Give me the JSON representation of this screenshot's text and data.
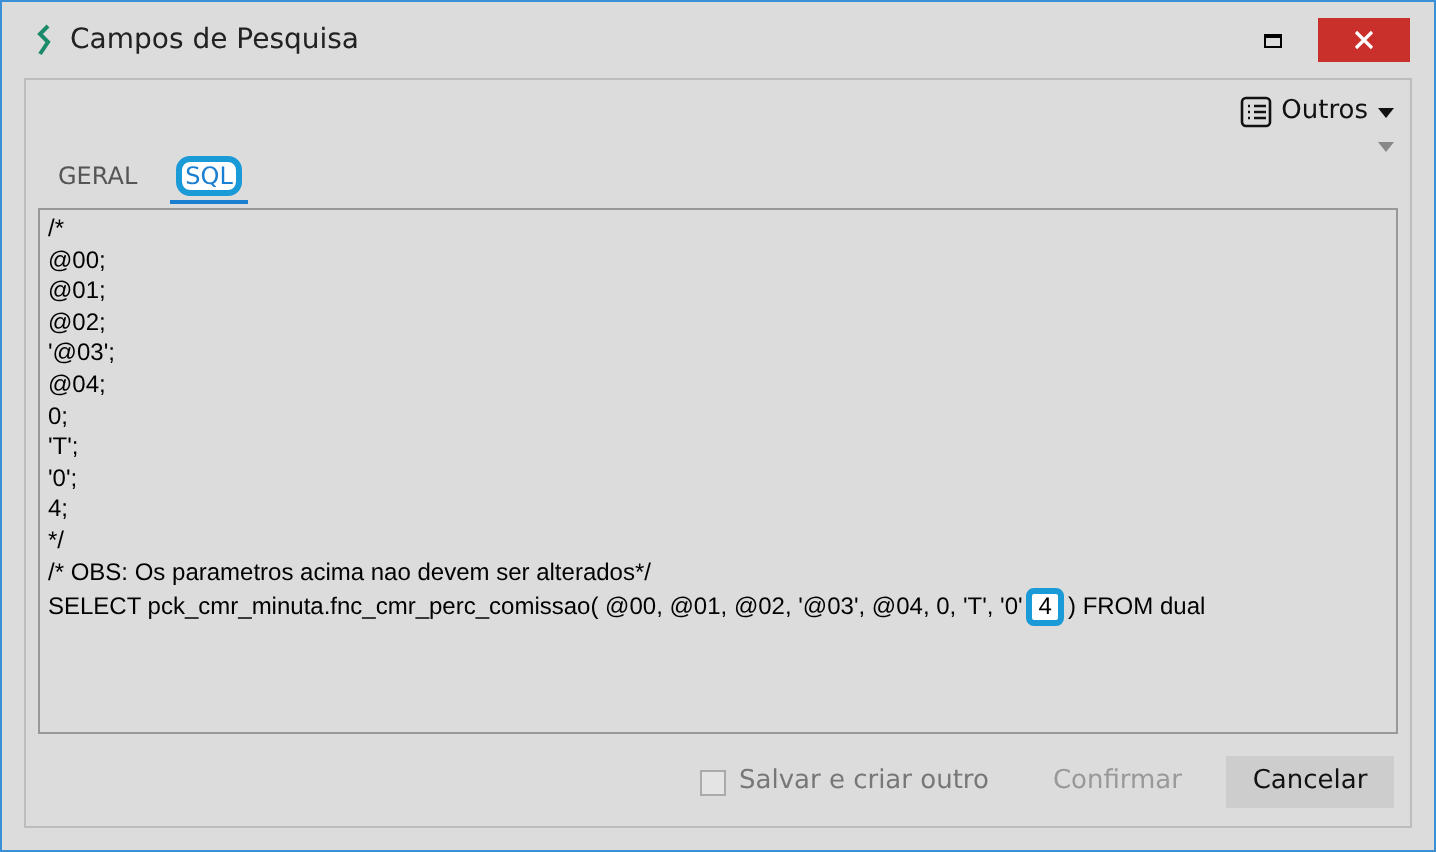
{
  "window": {
    "title": "Campos de Pesquisa"
  },
  "toolbar": {
    "menu_label": "Outros"
  },
  "tabs": [
    {
      "label": "GERAL",
      "selected": false,
      "highlighted": false
    },
    {
      "label": "SQL",
      "selected": true,
      "highlighted": true
    }
  ],
  "editor": {
    "lines": [
      "/*",
      "@00;",
      "@01;",
      "@02;",
      "'@03';",
      "@04;",
      "0;",
      "'T';",
      "'0';",
      "4;",
      "*/",
      "/* OBS: Os parametros acima nao devem ser alterados*/"
    ],
    "last_line": {
      "before": "SELECT pck_cmr_minuta.fnc_cmr_perc_comissao( @00, @01, @02, '@03', @04, 0, 'T', '0'",
      "highlighted": "4",
      "after": ") FROM dual"
    }
  },
  "footer": {
    "checkbox": {
      "label": "Salvar e criar outro",
      "checked": false,
      "disabled": true
    },
    "buttons": [
      {
        "label": "Confirmar",
        "disabled": true
      },
      {
        "label": "Cancelar",
        "disabled": false
      }
    ]
  }
}
